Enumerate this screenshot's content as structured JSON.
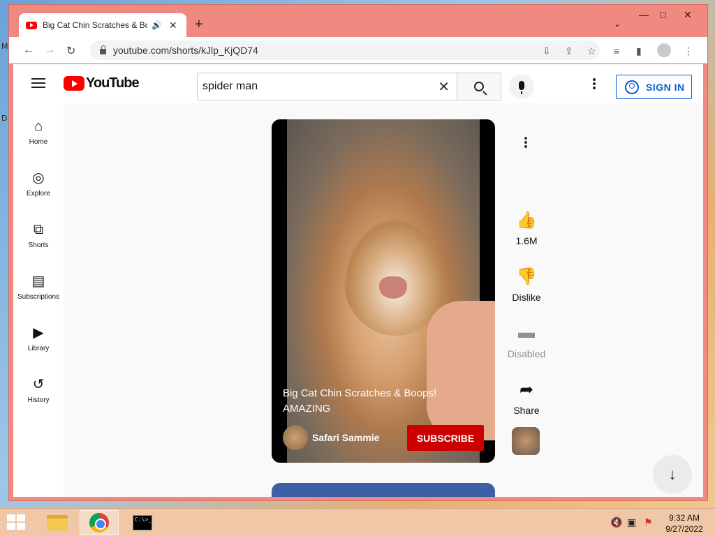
{
  "desktop": {
    "side_letters": [
      "M",
      "D"
    ]
  },
  "browser": {
    "tab": {
      "title": "Big Cat Chin Scratches & Boops!",
      "audio_icon": "speaker-icon"
    },
    "new_tab_label": "+",
    "url": "youtube.com/shorts/kJlp_KjQD74",
    "window_controls": {
      "minimize": "—",
      "maximize": "□",
      "close": "✕"
    }
  },
  "youtube": {
    "logo_text": "YouTube",
    "search": {
      "value": "spider man",
      "placeholder": "Search"
    },
    "sign_in_label": "SIGN IN",
    "guide": [
      {
        "label": "Home",
        "icon": "home-icon"
      },
      {
        "label": "Explore",
        "icon": "compass-icon"
      },
      {
        "label": "Shorts",
        "icon": "shorts-icon"
      },
      {
        "label": "Subscriptions",
        "icon": "subscriptions-icon"
      },
      {
        "label": "Library",
        "icon": "library-icon"
      },
      {
        "label": "History",
        "icon": "history-icon"
      }
    ],
    "short": {
      "title": "Big Cat Chin Scratches & Boops! AMAZING",
      "channel": "Safari Sammie",
      "subscribe_label": "SUBSCRIBE",
      "likes": "1.6M",
      "dislike_label": "Dislike",
      "comments_label": "Disabled",
      "share_label": "Share"
    }
  },
  "taskbar": {
    "time": "9:32 AM",
    "date": "9/27/2022",
    "cmd_text": "C:\\>_"
  }
}
